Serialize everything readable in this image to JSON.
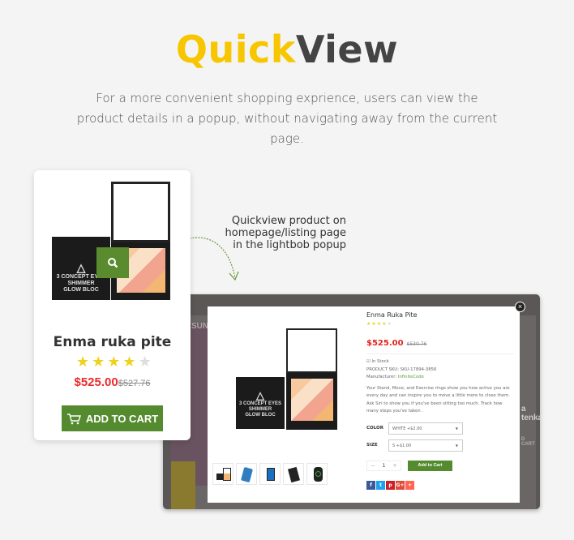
{
  "header": {
    "title_a": "Quick",
    "title_b": "View",
    "intro": "For a more convenient shopping exprience, users can view the product details in a popup, without navigating away from the current page."
  },
  "card": {
    "name": "Enma ruka pite",
    "rating": 4,
    "max_rating": 5,
    "price": "$525.00",
    "old_price": "$527.76",
    "cart_label": "ADD TO CART",
    "brand_lines": [
      "3 CONCEPT EYES",
      "SHIMMER",
      "GLOW BLOC"
    ]
  },
  "annotation": "Quickview product on homepage/listing page in the lightbob popup",
  "background_page": {
    "text1": "SUNG",
    "text2": "a tenka",
    "text3": "D CART"
  },
  "popup": {
    "name": "Enma Ruka Pite",
    "rating": 4,
    "price": "$525.00",
    "old_price": "$530.76",
    "stock": "In Stock",
    "sku_label": "PRODUCT SKU:",
    "sku": "SKU-17894-3856",
    "manufacturer_label": "Manufacturer:",
    "manufacturer": "InfiniteCode",
    "description": "Your Stand, Move, and Exercise rings show you how active you are every day and can inspire you to move a little more to close them. Ask Siri to show you if you've been sitting too much. Track how many steps you've taken .",
    "color_label": "COLOR",
    "color_value": "WHITE +$2.00",
    "size_label": "SIZE",
    "size_value": "S +$1.00",
    "qty": "1",
    "add_label": "Add to Cart",
    "share": [
      "f",
      "t",
      "p",
      "G+",
      "+"
    ],
    "share_colors": [
      "#3b5998",
      "#1da1f2",
      "#cb2027",
      "#dd4b39",
      "#ff6550"
    ],
    "thumbnails": [
      "compact",
      "phone-blue",
      "tablet",
      "phone-black",
      "watch"
    ]
  },
  "colors": {
    "accent_yellow": "#f7c600",
    "green": "#558b2f",
    "price_red": "#ee2a2a"
  }
}
